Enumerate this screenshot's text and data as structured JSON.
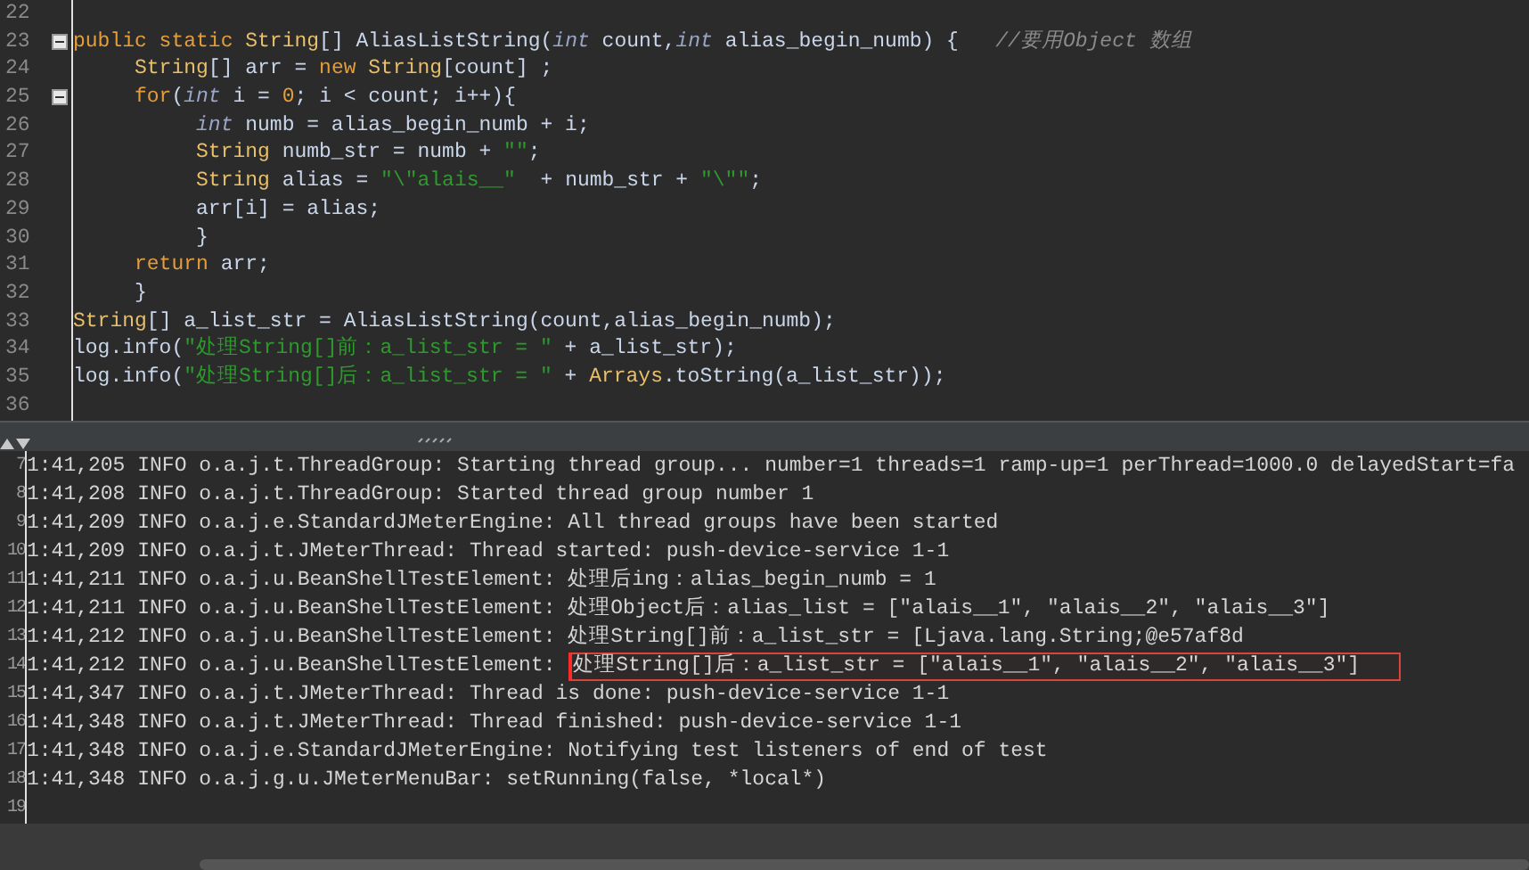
{
  "editor": {
    "lines": [
      {
        "number": "22",
        "fold": false
      },
      {
        "number": "23",
        "fold": true,
        "tokens": [
          {
            "kind": "keyword",
            "text": "public static "
          },
          {
            "kind": "type",
            "text": "String"
          },
          {
            "kind": "plain",
            "text": "[] AliasListString("
          },
          {
            "kind": "primitive",
            "text": "int"
          },
          {
            "kind": "plain",
            "text": " count,"
          },
          {
            "kind": "primitive",
            "text": "int"
          },
          {
            "kind": "plain",
            "text": " alias_begin_numb) {   "
          },
          {
            "kind": "comment",
            "text": "//要用Object 数组"
          }
        ]
      },
      {
        "number": "24",
        "fold": false,
        "tokens": [
          {
            "kind": "type",
            "text": "     String"
          },
          {
            "kind": "plain",
            "text": "[] arr = "
          },
          {
            "kind": "keyword",
            "text": "new "
          },
          {
            "kind": "type",
            "text": "String"
          },
          {
            "kind": "plain",
            "text": "[count] ;"
          }
        ]
      },
      {
        "number": "25",
        "fold": true,
        "tokens": [
          {
            "kind": "keyword",
            "text": "     for"
          },
          {
            "kind": "plain",
            "text": "("
          },
          {
            "kind": "primitive",
            "text": "int"
          },
          {
            "kind": "plain",
            "text": " i = "
          },
          {
            "kind": "number",
            "text": "0"
          },
          {
            "kind": "plain",
            "text": "; i < count; i++){"
          }
        ]
      },
      {
        "number": "26",
        "fold": false,
        "tokens": [
          {
            "kind": "primitive",
            "text": "          int"
          },
          {
            "kind": "plain",
            "text": " numb = alias_begin_numb + i;"
          }
        ]
      },
      {
        "number": "27",
        "fold": false,
        "tokens": [
          {
            "kind": "type",
            "text": "          String"
          },
          {
            "kind": "plain",
            "text": " numb_str = numb + "
          },
          {
            "kind": "string",
            "text": "\"\""
          },
          {
            "kind": "plain",
            "text": ";"
          }
        ]
      },
      {
        "number": "28",
        "fold": false,
        "tokens": [
          {
            "kind": "type",
            "text": "          String"
          },
          {
            "kind": "plain",
            "text": " alias = "
          },
          {
            "kind": "string",
            "text": "\"\\\"alais__\""
          },
          {
            "kind": "plain",
            "text": "  + numb_str + "
          },
          {
            "kind": "string",
            "text": "\"\\\"\""
          },
          {
            "kind": "plain",
            "text": ";"
          }
        ]
      },
      {
        "number": "29",
        "fold": false,
        "tokens": [
          {
            "kind": "plain",
            "text": "          arr[i] = alias;"
          }
        ]
      },
      {
        "number": "30",
        "fold": false,
        "tokens": [
          {
            "kind": "plain",
            "text": "          }"
          }
        ]
      },
      {
        "number": "31",
        "fold": false,
        "tokens": [
          {
            "kind": "keyword",
            "text": "     return"
          },
          {
            "kind": "plain",
            "text": " arr;"
          }
        ]
      },
      {
        "number": "32",
        "fold": false,
        "tokens": [
          {
            "kind": "plain",
            "text": "     }"
          }
        ]
      },
      {
        "number": "33",
        "fold": false,
        "tokens": [
          {
            "kind": "type",
            "text": "String"
          },
          {
            "kind": "plain",
            "text": "[] a_list_str = AliasListString(count,alias_begin_numb);"
          }
        ]
      },
      {
        "number": "34",
        "fold": false,
        "tokens": [
          {
            "kind": "plain",
            "text": "log.info("
          },
          {
            "kind": "string",
            "text": "\"处理String[]前：a_list_str = \""
          },
          {
            "kind": "plain",
            "text": " + a_list_str);"
          }
        ]
      },
      {
        "number": "35",
        "fold": false,
        "tokens": [
          {
            "kind": "plain",
            "text": "log.info("
          },
          {
            "kind": "string",
            "text": "\"处理String[]后：a_list_str = \""
          },
          {
            "kind": "plain",
            "text": " + "
          },
          {
            "kind": "type",
            "text": "Arrays"
          },
          {
            "kind": "plain",
            "text": ".toString(a_list_str));"
          }
        ]
      },
      {
        "number": "36",
        "fold": false
      }
    ]
  },
  "log": {
    "lines": [
      {
        "number": "7",
        "prefix": "1:41,205 INFO o.a.j.t.ThreadGroup: ",
        "message": "Starting thread group... number=1 threads=1 ramp-up=1 perThread=1000.0 delayedStart=fa",
        "highlighted": false
      },
      {
        "number": "8",
        "prefix": "1:41,208 INFO o.a.j.t.ThreadGroup: ",
        "message": "Started thread group number 1",
        "highlighted": false
      },
      {
        "number": "9",
        "prefix": "1:41,209 INFO o.a.j.e.StandardJMeterEngine: ",
        "message": "All thread groups have been started",
        "highlighted": false
      },
      {
        "number": "10",
        "prefix": "1:41,209 INFO o.a.j.t.JMeterThread: ",
        "message": "Thread started: push-device-service 1-1",
        "highlighted": false
      },
      {
        "number": "11",
        "prefix": "1:41,211 INFO o.a.j.u.BeanShellTestElement: ",
        "message": "处理后ing：alias_begin_numb = 1",
        "highlighted": false
      },
      {
        "number": "12",
        "prefix": "1:41,211 INFO o.a.j.u.BeanShellTestElement: ",
        "message": "处理Object后：alias_list = [\"alais__1\", \"alais__2\", \"alais__3\"]",
        "highlighted": false
      },
      {
        "number": "13",
        "prefix": "1:41,212 INFO o.a.j.u.BeanShellTestElement: ",
        "message": "处理String[]前：a_list_str = [Ljava.lang.String;@e57af8d",
        "highlighted": false
      },
      {
        "number": "14",
        "prefix": "1:41,212 INFO o.a.j.u.BeanShellTestElement: ",
        "message": "处理String[]后：a_list_str = [\"alais__1\", \"alais__2\", \"alais__3\"]",
        "highlighted": true
      },
      {
        "number": "15",
        "prefix": "1:41,347 INFO o.a.j.t.JMeterThread: ",
        "message": "Thread is done: push-device-service 1-1",
        "highlighted": false
      },
      {
        "number": "16",
        "prefix": "1:41,348 INFO o.a.j.t.JMeterThread: ",
        "message": "Thread finished: push-device-service 1-1",
        "highlighted": false
      },
      {
        "number": "17",
        "prefix": "1:41,348 INFO o.a.j.e.StandardJMeterEngine: ",
        "message": "Notifying test listeners of end of test",
        "highlighted": false
      },
      {
        "number": "18",
        "prefix": "1:41,348 INFO o.a.j.g.u.JMeterMenuBar: ",
        "message": "setRunning(false, *local*)",
        "highlighted": false
      },
      {
        "number": "19",
        "highlighted": false
      }
    ]
  }
}
